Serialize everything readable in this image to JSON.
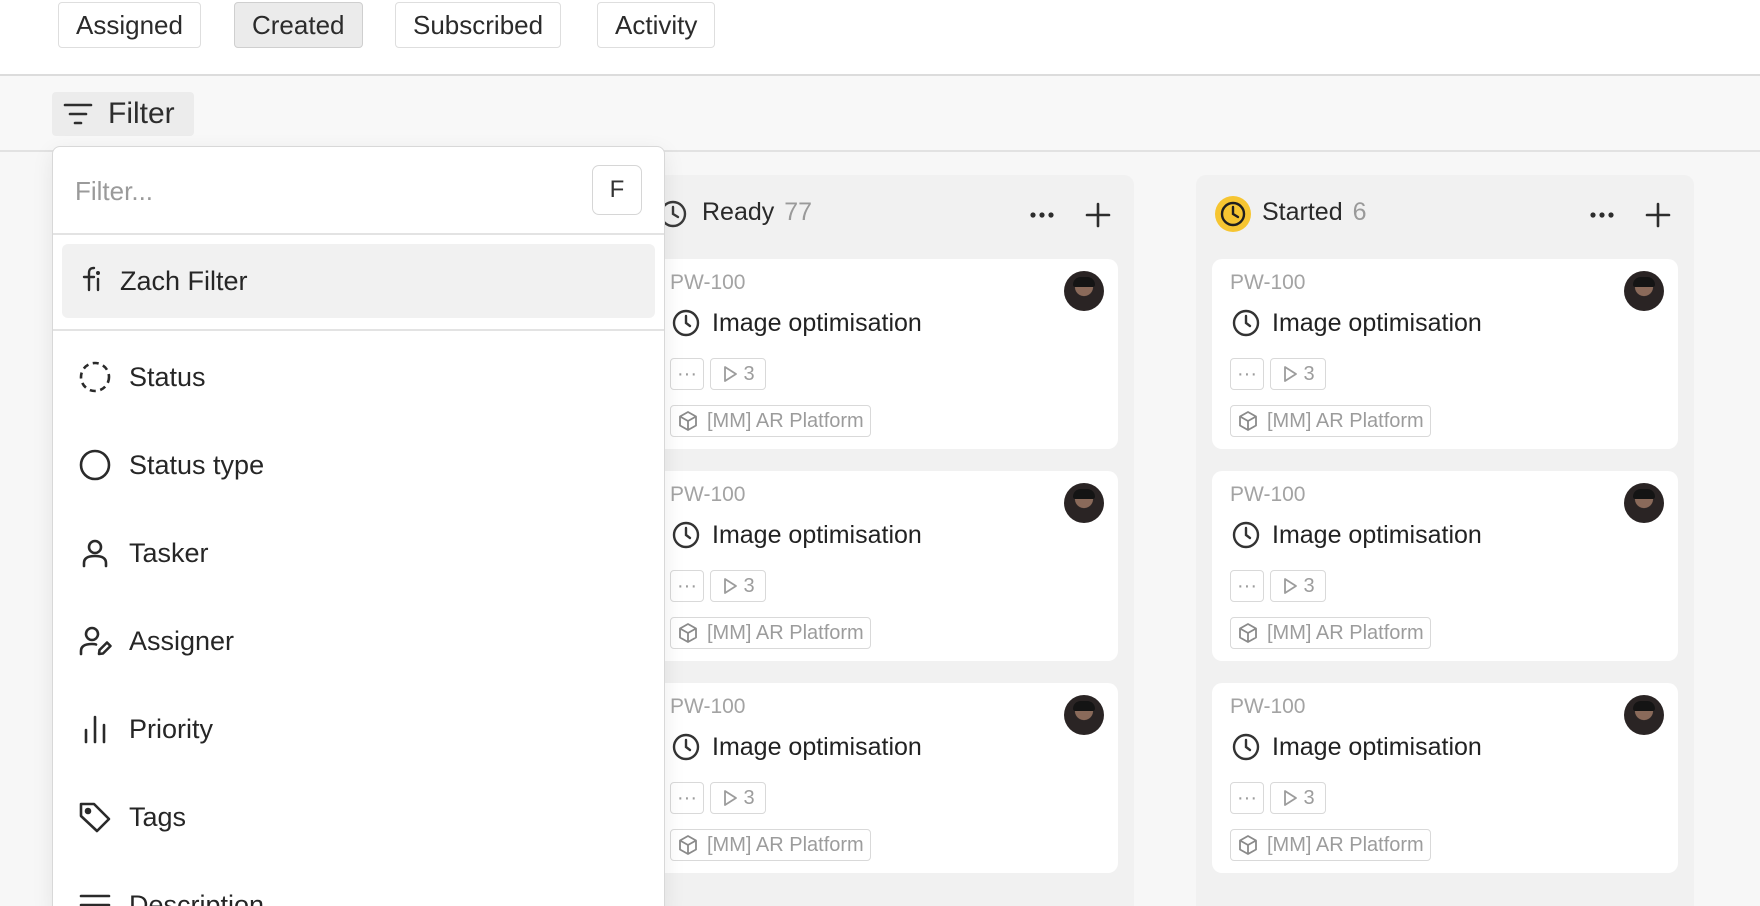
{
  "tabs": [
    {
      "label": "Assigned",
      "active": false
    },
    {
      "label": "Created",
      "active": true
    },
    {
      "label": "Subscribed",
      "active": false
    },
    {
      "label": "Activity",
      "active": false
    }
  ],
  "filter": {
    "button_label": "Filter",
    "search_placeholder": "Filter...",
    "shortcut_key": "F",
    "saved_filter": {
      "label": "Zach Filter",
      "icon": "function-icon"
    },
    "fields": [
      {
        "label": "Status",
        "icon": "dashed-circle-icon"
      },
      {
        "label": "Status type",
        "icon": "circle-icon"
      },
      {
        "label": "Tasker",
        "icon": "user-icon"
      },
      {
        "label": "Assigner",
        "icon": "user-edit-icon"
      },
      {
        "label": "Priority",
        "icon": "bar-chart-icon"
      },
      {
        "label": "Tags",
        "icon": "tag-icon"
      },
      {
        "label": "Description",
        "icon": "text-lines-icon"
      }
    ]
  },
  "columns": [
    {
      "title": "Ready",
      "count": "77",
      "status_icon": "ready-clock-icon",
      "cards": [
        {
          "id": "PW-100",
          "title": "Image optimisation",
          "subtasks": "3",
          "project": "[MM] AR Platform"
        },
        {
          "id": "PW-100",
          "title": "Image optimisation",
          "subtasks": "3",
          "project": "[MM] AR Platform"
        },
        {
          "id": "PW-100",
          "title": "Image optimisation",
          "subtasks": "3",
          "project": "[MM] AR Platform"
        }
      ]
    },
    {
      "title": "Started",
      "count": "6",
      "status_icon": "started-clock-icon",
      "accent": "#f6c531",
      "cards": [
        {
          "id": "PW-100",
          "title": "Image optimisation",
          "subtasks": "3",
          "project": "[MM] AR Platform"
        },
        {
          "id": "PW-100",
          "title": "Image optimisation",
          "subtasks": "3",
          "project": "[MM] AR Platform"
        },
        {
          "id": "PW-100",
          "title": "Image optimisation",
          "subtasks": "3",
          "project": "[MM] AR Platform"
        }
      ]
    }
  ]
}
